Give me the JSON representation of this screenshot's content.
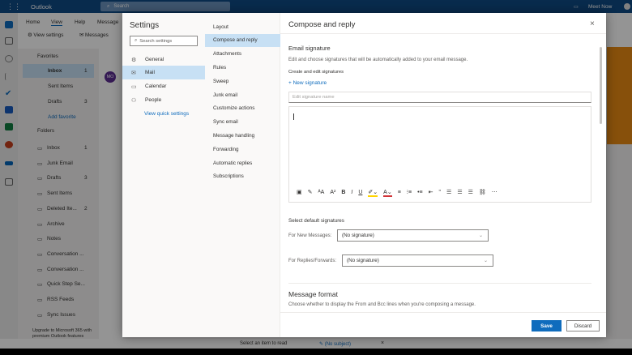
{
  "app": {
    "name": "Outlook",
    "search_placeholder": "Search",
    "meet_now": "Meet Now"
  },
  "ribbon": {
    "tabs": [
      "Home",
      "View",
      "Help",
      "Message"
    ],
    "view_settings": "View settings",
    "messages": "Messages"
  },
  "folders": {
    "favorites": "Favorites",
    "fav_items": [
      {
        "label": "Inbox",
        "count": "1"
      },
      {
        "label": "Sent Items",
        "count": ""
      },
      {
        "label": "Drafts",
        "count": "3"
      }
    ],
    "add_favorite": "Add favorite",
    "folders_label": "Folders",
    "items": [
      {
        "label": "Inbox",
        "count": "1"
      },
      {
        "label": "Junk Email",
        "count": ""
      },
      {
        "label": "Drafts",
        "count": "3"
      },
      {
        "label": "Sent Items",
        "count": ""
      },
      {
        "label": "Deleted Ite...",
        "count": "2"
      },
      {
        "label": "Archive",
        "count": ""
      },
      {
        "label": "Notes",
        "count": ""
      },
      {
        "label": "Conversation ...",
        "count": ""
      },
      {
        "label": "Conversation ...",
        "count": ""
      },
      {
        "label": "Quick Step Se...",
        "count": ""
      },
      {
        "label": "RSS Feeds",
        "count": ""
      },
      {
        "label": "Sync Issues",
        "count": ""
      }
    ],
    "upgrade": "Upgrade to Microsoft 365 with premium Outlook features"
  },
  "list": {
    "avatar": "MO"
  },
  "status": {
    "select_item": "Select an item to read",
    "draft": "(No subject)"
  },
  "settings": {
    "title": "Settings",
    "search_placeholder": "Search settings",
    "categories": [
      {
        "label": "General",
        "icon": "gear-icon"
      },
      {
        "label": "Mail",
        "icon": "mail-icon"
      },
      {
        "label": "Calendar",
        "icon": "calendar-icon"
      },
      {
        "label": "People",
        "icon": "people-icon"
      }
    ],
    "quick": "View quick settings",
    "mail_sections": [
      "Layout",
      "Compose and reply",
      "Attachments",
      "Rules",
      "Sweep",
      "Junk email",
      "Customize actions",
      "Sync email",
      "Message handling",
      "Forwarding",
      "Automatic replies",
      "Subscriptions"
    ]
  },
  "compose": {
    "title": "Compose and reply",
    "sig_heading": "Email signature",
    "sig_desc": "Edit and choose signatures that will be automatically added to your email message.",
    "create_label": "Create and edit signatures",
    "new_sig": "New signature",
    "name_placeholder": "Edit signature name",
    "default_heading": "Select default signatures",
    "new_msg_label": "For New Messages:",
    "new_msg_value": "(No signature)",
    "reply_label": "For Replies/Forwards:",
    "reply_value": "(No signature)",
    "format_heading": "Message format",
    "format_desc": "Choose whether to display the From and Bcc lines when you're composing a message.",
    "save": "Save",
    "discard": "Discard"
  }
}
